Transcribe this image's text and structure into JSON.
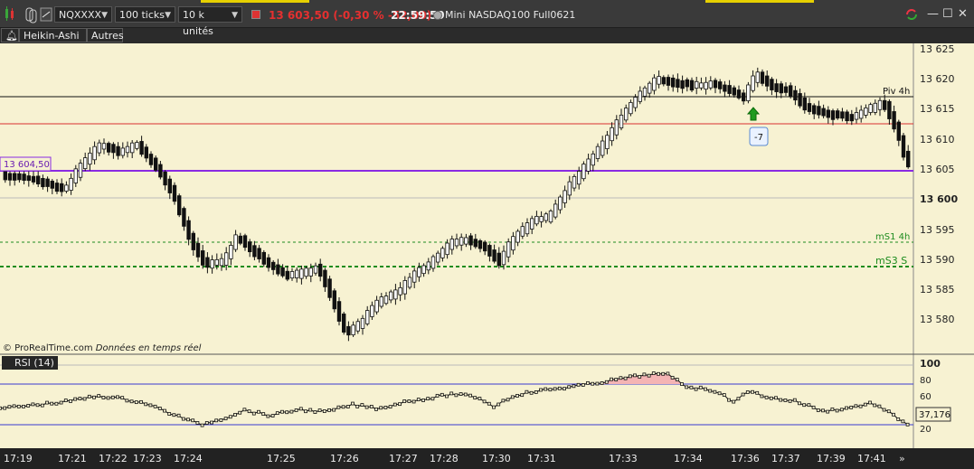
{
  "toolbar": {
    "symbol": "NQXXXX",
    "tick_mode": "100 ticks",
    "units": "10 k unités",
    "last_price_change": "13 603,50 (-0,30 % -52,00)",
    "time": "22:59:59",
    "instrument": "Mini NASDAQ100 Full0621"
  },
  "row2": {
    "chart_type": "Heikin-Ashi",
    "other": "Autres"
  },
  "price_axis": {
    "labels": [
      "13 625",
      "13 620",
      "13 615",
      "13 610",
      "13 605",
      "13 600",
      "13 595",
      "13 590",
      "13 585",
      "13 580"
    ],
    "current_tag": "13 604,50"
  },
  "annotations": {
    "pivot": "Piv 4h",
    "ms1": "mS1 4h",
    "ms3": "mS3 S",
    "signal_badge": "-7"
  },
  "credit": {
    "provider": "© ProRealTime.com",
    "note": "Données en temps réel"
  },
  "rsi": {
    "label": "RSI (14)",
    "axis": [
      "100",
      "80",
      "60",
      "40",
      "20"
    ],
    "value": "37,176"
  },
  "time_axis": [
    "17:19",
    "17:21",
    "17:22",
    "17:23",
    "17:24",
    "17:25",
    "17:26",
    "17:27",
    "17:28",
    "17:30",
    "17:31",
    "17:33",
    "17:34",
    "17:36",
    "17:37",
    "17:39",
    "17:41"
  ],
  "colors": {
    "background": "#f7f2d2",
    "pivot_line": "#111111",
    "resistance_line": "#d83030",
    "current_line": "#8a2be2",
    "support_line": "#1e8c1e",
    "up_arrow": "#1f9a1f"
  }
}
